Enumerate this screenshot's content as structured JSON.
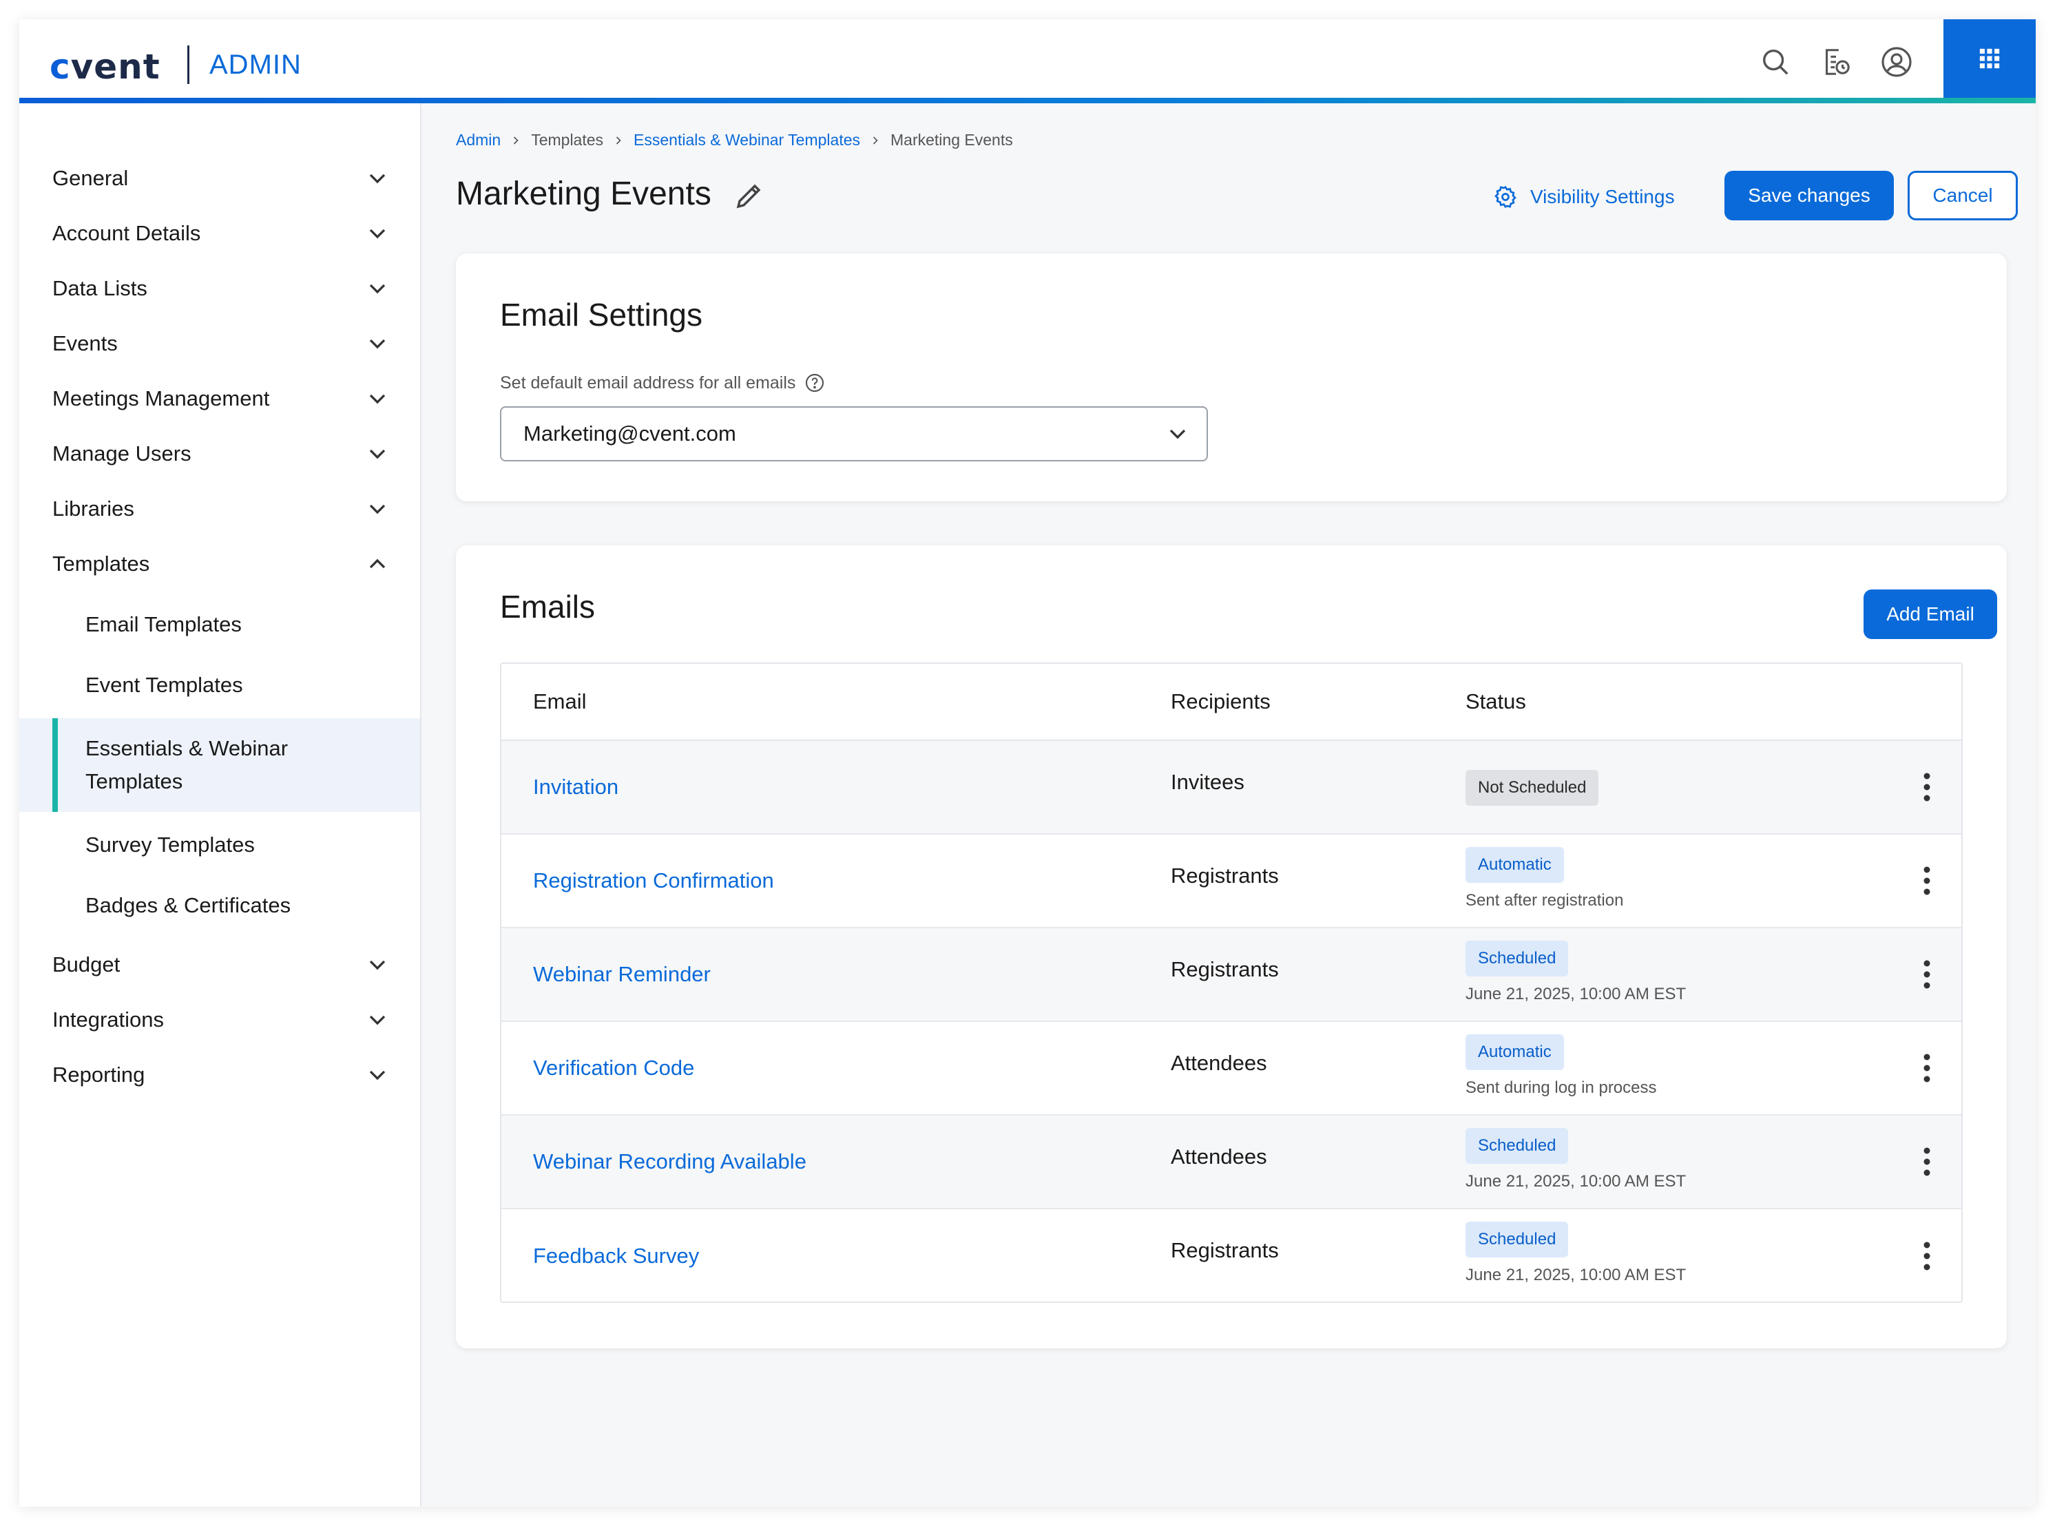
{
  "header": {
    "logo": "cvent",
    "section": "ADMIN",
    "icons": [
      "search-icon",
      "tasks-history-icon",
      "user-profile-icon",
      "apps-grid-icon"
    ]
  },
  "sidebar": {
    "items": [
      {
        "label": "General",
        "expanded": false
      },
      {
        "label": "Account Details",
        "expanded": false
      },
      {
        "label": "Data Lists",
        "expanded": false
      },
      {
        "label": "Events",
        "expanded": false
      },
      {
        "label": "Meetings Management",
        "expanded": false
      },
      {
        "label": "Manage Users",
        "expanded": false
      },
      {
        "label": "Libraries",
        "expanded": false
      },
      {
        "label": "Templates",
        "expanded": true
      },
      {
        "label": "Budget",
        "expanded": false
      },
      {
        "label": "Integrations",
        "expanded": false
      },
      {
        "label": "Reporting",
        "expanded": false
      }
    ],
    "templates_children": [
      {
        "label": "Email Templates"
      },
      {
        "label": "Event Templates"
      },
      {
        "label": "Essentials & Webinar Templates",
        "active": true
      },
      {
        "label": "Survey Templates"
      },
      {
        "label": "Badges & Certificates"
      }
    ]
  },
  "breadcrumb": [
    {
      "label": "Admin",
      "link": true
    },
    {
      "label": "Templates",
      "link": false
    },
    {
      "label": "Essentials & Webinar Templates",
      "link": true
    },
    {
      "label": "Marketing Events",
      "link": false
    }
  ],
  "page": {
    "title": "Marketing Events",
    "visibility_label": "Visibility Settings",
    "save_label": "Save changes",
    "cancel_label": "Cancel"
  },
  "email_settings": {
    "title": "Email Settings",
    "field_label": "Set default email address for all emails",
    "selected_value": "Marketing@cvent.com"
  },
  "emails": {
    "title": "Emails",
    "add_label": "Add Email",
    "columns": [
      "Email",
      "Recipients",
      "Status"
    ],
    "rows": [
      {
        "name": "Invitation",
        "recipients": "Invitees",
        "status": "Not Scheduled",
        "status_kind": "grey",
        "detail": ""
      },
      {
        "name": "Registration Confirmation",
        "recipients": "Registrants",
        "status": "Automatic",
        "status_kind": "blue",
        "detail": "Sent after registration"
      },
      {
        "name": "Webinar Reminder",
        "recipients": "Registrants",
        "status": "Scheduled",
        "status_kind": "blue",
        "detail": "June 21, 2025, 10:00 AM EST"
      },
      {
        "name": "Verification Code",
        "recipients": "Attendees",
        "status": "Automatic",
        "status_kind": "blue",
        "detail": "Sent during log in process"
      },
      {
        "name": "Webinar Recording Available",
        "recipients": "Attendees",
        "status": "Scheduled",
        "status_kind": "blue",
        "detail": "June 21, 2025, 10:00 AM EST"
      },
      {
        "name": "Feedback Survey",
        "recipients": "Registrants",
        "status": "Scheduled",
        "status_kind": "blue",
        "detail": "June 21, 2025, 10:00 AM EST"
      }
    ]
  },
  "colors": {
    "primary": "#0a6ad9",
    "accent_teal": "#1ab5a6",
    "navy": "#1d2a48"
  }
}
